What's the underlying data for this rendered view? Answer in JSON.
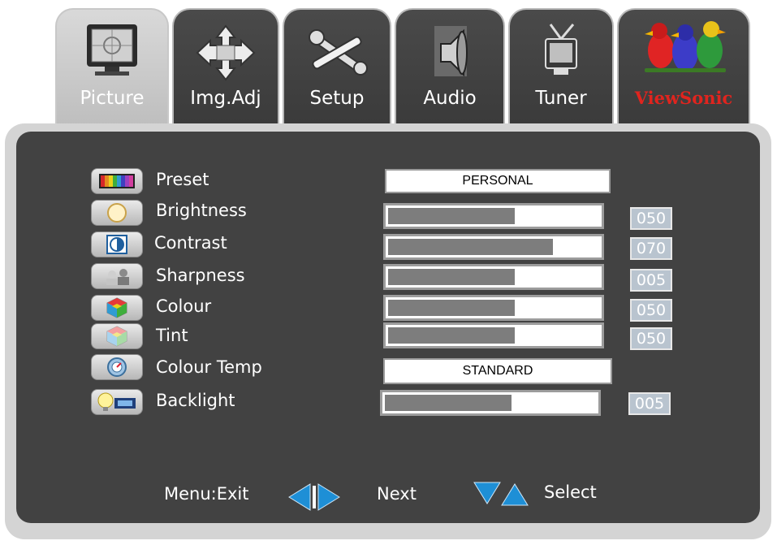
{
  "tabs": [
    {
      "label": "Picture",
      "icon": "monitor-icon",
      "active": true
    },
    {
      "label": "Img.Adj",
      "icon": "move-arrows-icon",
      "active": false
    },
    {
      "label": "Setup",
      "icon": "tools-icon",
      "active": false
    },
    {
      "label": "Audio",
      "icon": "speaker-icon",
      "active": false
    },
    {
      "label": "Tuner",
      "icon": "tv-antenna-icon",
      "active": false
    }
  ],
  "brand": {
    "logo_text": "ViewSonic",
    "logo_icon": "birds-logo-icon"
  },
  "settings": {
    "preset": {
      "label": "Preset",
      "value": "PERSONAL",
      "icon": "color-bars-icon"
    },
    "brightness": {
      "label": "Brightness",
      "value": "050",
      "level": 0.6,
      "icon": "sun-icon"
    },
    "contrast": {
      "label": "Contrast",
      "value": "070",
      "level": 0.78,
      "icon": "contrast-icon"
    },
    "sharpness": {
      "label": "Sharpness",
      "value": "005",
      "level": 0.6,
      "icon": "sharpness-icon"
    },
    "colour": {
      "label": "Colour",
      "value": "050",
      "level": 0.6,
      "icon": "color-cube-icon"
    },
    "tint": {
      "label": "Tint",
      "value": "050",
      "level": 0.6,
      "icon": "tint-cube-icon"
    },
    "colour_temp": {
      "label": "Colour Temp",
      "value": "STANDARD",
      "icon": "thermometer-dial-icon"
    },
    "backlight": {
      "label": "Backlight",
      "value": "005",
      "level": 0.6,
      "icon": "backlight-bulb-icon"
    }
  },
  "footer": {
    "exit_label": "Menu:Exit",
    "next_label": "Next",
    "select_label": "Select",
    "next_icon": "left-right-arrows-icon",
    "select_icon": "down-up-arrows-icon"
  },
  "colors": {
    "panel": "#424242",
    "accent": "#1e8fd6",
    "value_box": "#b9c4cf"
  }
}
